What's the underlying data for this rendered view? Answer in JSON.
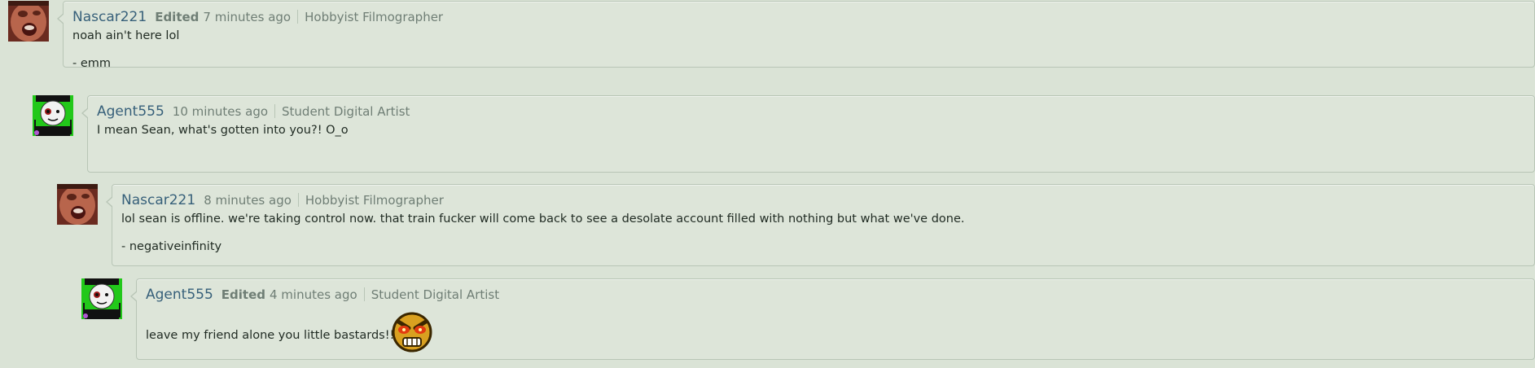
{
  "comments": [
    {
      "username": "Nascar221",
      "edited": "Edited",
      "time": "7 minutes ago",
      "role": "Hobbyist Filmographer",
      "lines": [
        "noah ain't here lol",
        "- emm"
      ]
    },
    {
      "username": "Agent555",
      "edited": "",
      "time": "10 minutes ago",
      "role": "Student Digital Artist",
      "lines": [
        "I mean Sean, what's gotten into you?! O_o"
      ]
    },
    {
      "username": "Nascar221",
      "edited": "",
      "time": "8 minutes ago",
      "role": "Hobbyist Filmographer",
      "lines": [
        "lol sean is offline. we're taking control now. that train fucker will come back to see a desolate account filled with nothing but what we've done.",
        "- negativeinfinity"
      ]
    },
    {
      "username": "Agent555",
      "edited": "Edited",
      "time": "4 minutes ago",
      "role": "Student Digital Artist",
      "lines": [
        "leave my friend alone you little bastards!!!"
      ],
      "emoticon": "angry-face-emoticon"
    }
  ],
  "colors": {
    "page_bg": "#dae3d6",
    "bubble_bg": "#dde5d9",
    "border": "#b8c5b6",
    "username": "#37607a",
    "meta": "#6f7e75"
  }
}
